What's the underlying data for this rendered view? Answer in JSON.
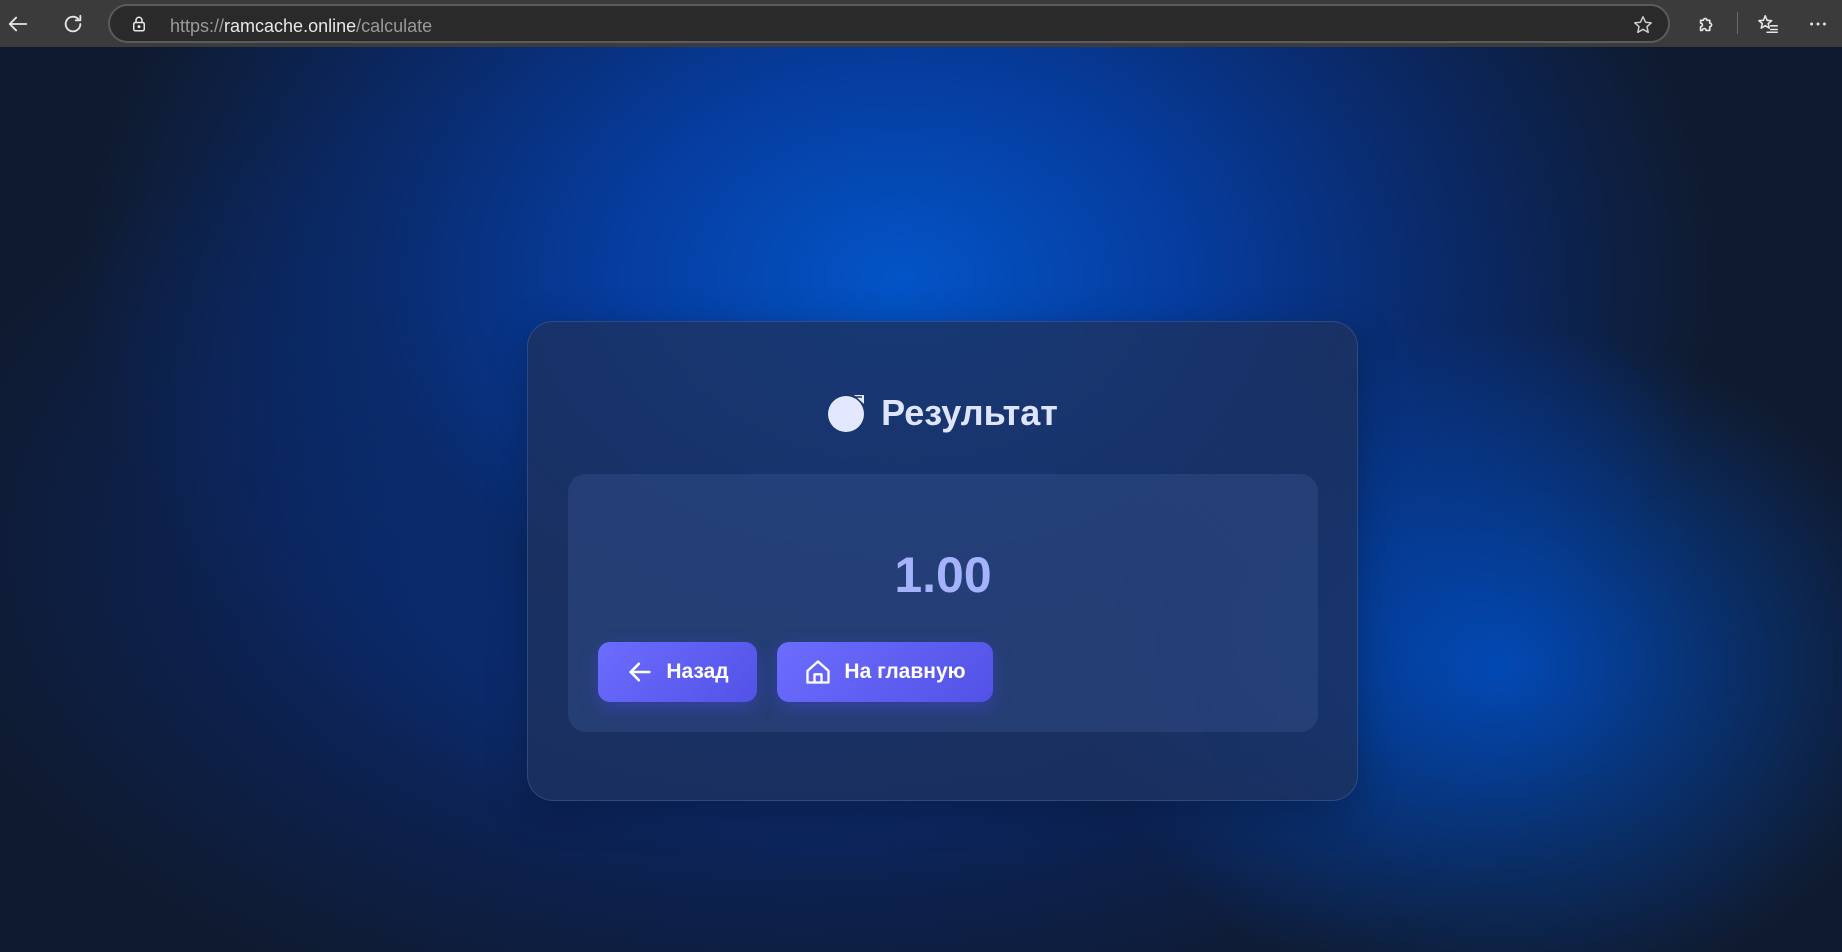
{
  "browser": {
    "url_scheme": "https://",
    "url_host": "ramcache.online",
    "url_path": "/calculate",
    "icons": {
      "back": "arrow-left-icon",
      "reload": "reload-icon",
      "lock": "lock-icon",
      "favorite": "star-icon",
      "extensions": "puzzle-icon",
      "favorites": "favorites-list-icon",
      "menu": "more-icon"
    }
  },
  "card": {
    "title": "Результат",
    "title_icon": "result-icon",
    "value": "1.00",
    "buttons": {
      "back_label": "Назад",
      "home_label": "На главную"
    }
  },
  "colors": {
    "accent": "#5e5ef2",
    "title": "#dfe4ff",
    "value": "#a5b3ff",
    "background": "#0f1a2e"
  }
}
